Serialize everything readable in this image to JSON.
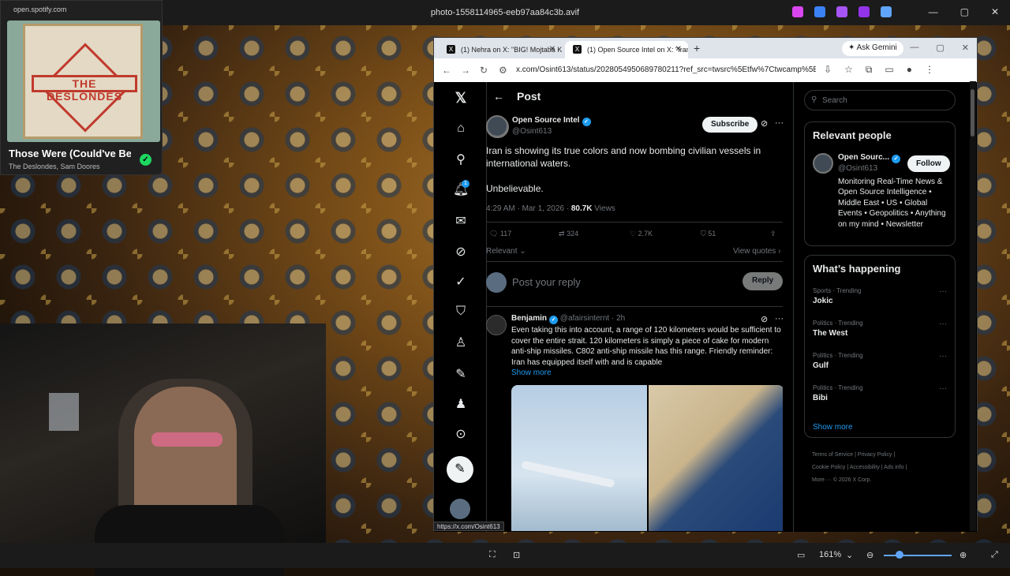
{
  "viewer": {
    "file_title": "photo-1558114965-eeb97aa84c3b.avif",
    "zoom": "161%"
  },
  "spotify": {
    "url": "open.spotify.com",
    "album_text": "THE DESLONDES",
    "song": "Those Were (Could've Be",
    "artists": "The Deslondes, Sam Doores"
  },
  "browser": {
    "tabs": [
      {
        "label": "(1) Nehra on X: \"BIG! Mojtaba K"
      },
      {
        "label": "(1) Open Source Intel on X: \"Iran"
      }
    ],
    "ask_gemini": "Ask Gemini",
    "url": "x.com/Osint613/status/2028054950689780211?ref_src=twsrc%5Etfw%7Ctwcamp%5Etweet...",
    "status_url": "https://x.com/Osint613"
  },
  "x": {
    "header_title": "Post",
    "notifications_count": "1",
    "post": {
      "name": "Open Source Intel",
      "handle": "@Osint613",
      "subscribe": "Subscribe",
      "text": "Iran is showing its true colors and now bombing civilian vessels in international waters.",
      "text2": "Unbelievable.",
      "meta": "4:29 AM · Mar 1, 2026 · ",
      "views_count": "80.7K",
      "views_label": " Views",
      "replies": "117",
      "reposts": "324",
      "likes": "2.7K",
      "bookmarks": "51",
      "relevant": "Relevant",
      "view_quotes": "View quotes"
    },
    "reply_placeholder": "Post your reply",
    "reply_button": "Reply",
    "comment": {
      "name": "Benjamin",
      "handle": "@afairsinternt",
      "time": "· 2h",
      "text": "Even taking this into account, a range of 120 kilometers would be sufficient to cover the entire strait. 120 kilometers is simply a piece of cake for modern anti-ship missiles. C802 anti-ship missile has this range. Friendly reminder: Iran has equipped itself with and is capable",
      "show_more": "Show more"
    },
    "search_placeholder": "Search",
    "relevant_people": {
      "title": "Relevant people",
      "name": "Open Sourc...",
      "handle": "@Osint613",
      "follow": "Follow",
      "bio": "Monitoring Real-Time News & Open Source Intelligence • Middle East • US • Global Events • Geopolitics • Anything on my mind • Newsletter"
    },
    "whats_happening": {
      "title": "What’s happening",
      "trends": [
        {
          "category": "Sports · Trending",
          "name": "Jokic"
        },
        {
          "category": "Politics · Trending",
          "name": "The West"
        },
        {
          "category": "Politics · Trending",
          "name": "Gulf"
        },
        {
          "category": "Politics · Trending",
          "name": "Bibi"
        }
      ],
      "show_more": "Show more"
    },
    "footer": {
      "line1": "Terms of Service  |  Privacy Policy  |",
      "line2": "Cookie Policy  |  Accessibility  |  Ads info  |",
      "line3": "More ···  © 2026 X Corp."
    }
  },
  "colors": {
    "x_blue": "#1d9bf0",
    "spotify_green": "#1ed760"
  }
}
